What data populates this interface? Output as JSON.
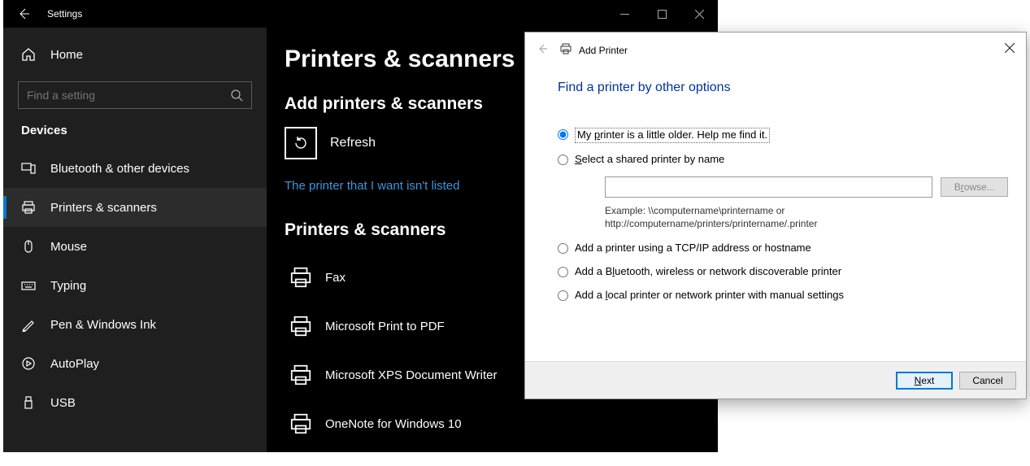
{
  "window": {
    "title": "Settings"
  },
  "sidebar": {
    "home": "Home",
    "search_placeholder": "Find a setting",
    "category": "Devices",
    "items": [
      {
        "label": "Bluetooth & other devices"
      },
      {
        "label": "Printers & scanners"
      },
      {
        "label": "Mouse"
      },
      {
        "label": "Typing"
      },
      {
        "label": "Pen & Windows Ink"
      },
      {
        "label": "AutoPlay"
      },
      {
        "label": "USB"
      }
    ]
  },
  "content": {
    "page_title": "Printers & scanners",
    "add_heading": "Add printers & scanners",
    "refresh_label": "Refresh",
    "not_listed_link": "The printer that I want isn't listed",
    "list_heading": "Printers & scanners",
    "printers": [
      {
        "name": "Fax"
      },
      {
        "name": "Microsoft Print to PDF"
      },
      {
        "name": "Microsoft XPS Document Writer"
      },
      {
        "name": "OneNote for Windows 10"
      }
    ]
  },
  "dialog": {
    "header": "Add Printer",
    "title": "Find a printer by other options",
    "options": {
      "older_pre": "My ",
      "older_key": "p",
      "older_post": "rinter is a little older. Help me find it.",
      "shared_pre": "",
      "shared_key": "S",
      "shared_post": "elect a shared printer by name",
      "tcpip": "Add a printer using a TCP/IP address or hostname",
      "bt_pre": "Add a B",
      "bt_key": "l",
      "bt_post": "uetooth, wireless or network discoverable printer",
      "local_pre": "Add a ",
      "local_key": "l",
      "local_post": "ocal printer or network printer with manual settings"
    },
    "browse_pre": "B",
    "browse_key": "r",
    "browse_post": "owse...",
    "example_line1": "Example: \\\\computername\\printername or",
    "example_line2": "http://computername/printers/printername/.printer",
    "next_key": "N",
    "next_post": "ext",
    "cancel": "Cancel"
  }
}
